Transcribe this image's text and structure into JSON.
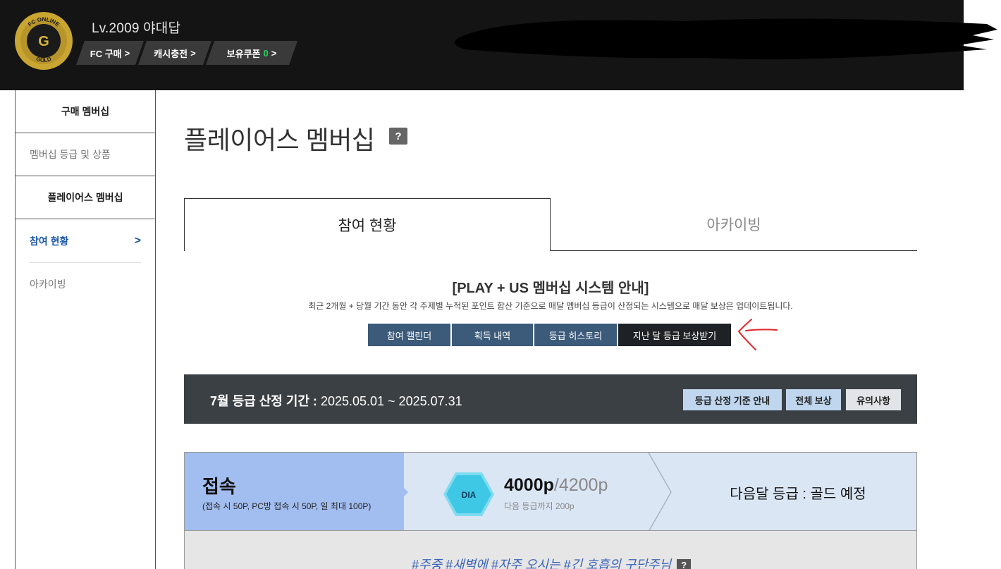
{
  "header": {
    "badge_top_text": "FC ONLINE",
    "badge_letter": "G",
    "badge_bottom_text": "GOLD",
    "username": "Lv.2009 야대답",
    "pills": [
      {
        "label": "FC 구매",
        "arrow": ">"
      },
      {
        "label": "캐시충전",
        "arrow": ">"
      },
      {
        "label": "보유쿠폰",
        "count": "0",
        "arrow": ">"
      }
    ]
  },
  "sidebar": {
    "items": [
      {
        "label": "구매 멤버십"
      },
      {
        "label": "멤버십 등급 및 상품"
      },
      {
        "label": "플레이어스 멤버십"
      },
      {
        "label": "참여 현황",
        "arrow": ">"
      },
      {
        "label": "아카이빙"
      }
    ]
  },
  "main": {
    "title": "플레이어스 멤버십",
    "help_icon": "?",
    "tabs": [
      {
        "label": "참여 현황",
        "active": true
      },
      {
        "label": "아카이빙",
        "active": false
      }
    ],
    "notice_title": "[PLAY + US 멤버십 시스템 안내]",
    "notice_desc": "최근 2개월 + 당월 기간 동안 각 주제별 누적된 포인트 합산 기준으로 매달 멤버십 등급이 산정되는 시스템으로 매달 보상은 업데이트됩니다.",
    "buttons": [
      "참여 캘린더",
      "획득 내역",
      "등급 히스토리",
      "지난 달 등급 보상받기"
    ],
    "period": {
      "label": "7월 등급 산정 기간 :",
      "range": "2025.05.01 ~ 2025.07.31",
      "buttons": [
        "등급 산정 기준 안내",
        "전체 보상",
        "유의사항"
      ]
    },
    "card": {
      "title": "접속",
      "desc": "(접속 시 50P, PC방 접속 시 50P, 일 최대 100P)",
      "grade": "DIA",
      "points": "4000p",
      "max_points": "/4200p",
      "remaining": "다음 등급까지 200p",
      "next_grade": "다음달 등급 : 골드 예정"
    },
    "hashtags": "#주중 #새벽에 #자주 오시는 #긴 호흡의 구단주님",
    "hash_help": "?"
  },
  "colors": {
    "header_bg": "#141414",
    "accent_blue": "#1a56a8",
    "button_blue": "#3c5a7a",
    "period_bg": "#3b4044",
    "card_left": "#a2bef0",
    "card_bg": "#dbe6f5",
    "dia_hex": "#3fc8e6",
    "gold": "#c9a531",
    "annotation_red": "#e0262b"
  }
}
